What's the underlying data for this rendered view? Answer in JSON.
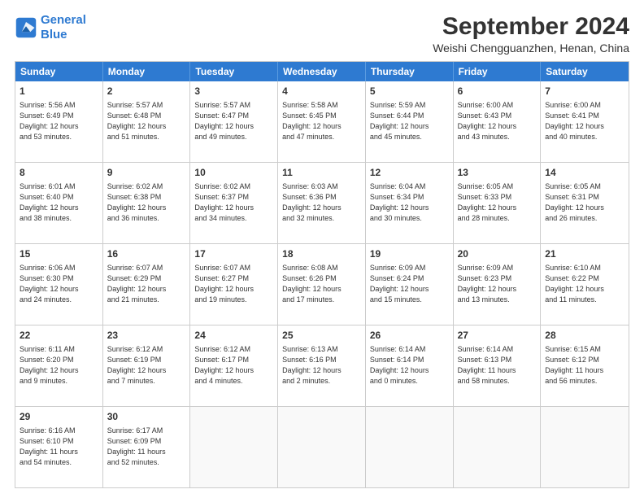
{
  "header": {
    "logo_general": "General",
    "logo_blue": "Blue",
    "month_title": "September 2024",
    "location": "Weishi Chengguanzhen, Henan, China"
  },
  "weekdays": [
    "Sunday",
    "Monday",
    "Tuesday",
    "Wednesday",
    "Thursday",
    "Friday",
    "Saturday"
  ],
  "rows": [
    [
      {
        "day": "1",
        "lines": [
          "Sunrise: 5:56 AM",
          "Sunset: 6:49 PM",
          "Daylight: 12 hours",
          "and 53 minutes."
        ]
      },
      {
        "day": "2",
        "lines": [
          "Sunrise: 5:57 AM",
          "Sunset: 6:48 PM",
          "Daylight: 12 hours",
          "and 51 minutes."
        ]
      },
      {
        "day": "3",
        "lines": [
          "Sunrise: 5:57 AM",
          "Sunset: 6:47 PM",
          "Daylight: 12 hours",
          "and 49 minutes."
        ]
      },
      {
        "day": "4",
        "lines": [
          "Sunrise: 5:58 AM",
          "Sunset: 6:45 PM",
          "Daylight: 12 hours",
          "and 47 minutes."
        ]
      },
      {
        "day": "5",
        "lines": [
          "Sunrise: 5:59 AM",
          "Sunset: 6:44 PM",
          "Daylight: 12 hours",
          "and 45 minutes."
        ]
      },
      {
        "day": "6",
        "lines": [
          "Sunrise: 6:00 AM",
          "Sunset: 6:43 PM",
          "Daylight: 12 hours",
          "and 43 minutes."
        ]
      },
      {
        "day": "7",
        "lines": [
          "Sunrise: 6:00 AM",
          "Sunset: 6:41 PM",
          "Daylight: 12 hours",
          "and 40 minutes."
        ]
      }
    ],
    [
      {
        "day": "8",
        "lines": [
          "Sunrise: 6:01 AM",
          "Sunset: 6:40 PM",
          "Daylight: 12 hours",
          "and 38 minutes."
        ]
      },
      {
        "day": "9",
        "lines": [
          "Sunrise: 6:02 AM",
          "Sunset: 6:38 PM",
          "Daylight: 12 hours",
          "and 36 minutes."
        ]
      },
      {
        "day": "10",
        "lines": [
          "Sunrise: 6:02 AM",
          "Sunset: 6:37 PM",
          "Daylight: 12 hours",
          "and 34 minutes."
        ]
      },
      {
        "day": "11",
        "lines": [
          "Sunrise: 6:03 AM",
          "Sunset: 6:36 PM",
          "Daylight: 12 hours",
          "and 32 minutes."
        ]
      },
      {
        "day": "12",
        "lines": [
          "Sunrise: 6:04 AM",
          "Sunset: 6:34 PM",
          "Daylight: 12 hours",
          "and 30 minutes."
        ]
      },
      {
        "day": "13",
        "lines": [
          "Sunrise: 6:05 AM",
          "Sunset: 6:33 PM",
          "Daylight: 12 hours",
          "and 28 minutes."
        ]
      },
      {
        "day": "14",
        "lines": [
          "Sunrise: 6:05 AM",
          "Sunset: 6:31 PM",
          "Daylight: 12 hours",
          "and 26 minutes."
        ]
      }
    ],
    [
      {
        "day": "15",
        "lines": [
          "Sunrise: 6:06 AM",
          "Sunset: 6:30 PM",
          "Daylight: 12 hours",
          "and 24 minutes."
        ]
      },
      {
        "day": "16",
        "lines": [
          "Sunrise: 6:07 AM",
          "Sunset: 6:29 PM",
          "Daylight: 12 hours",
          "and 21 minutes."
        ]
      },
      {
        "day": "17",
        "lines": [
          "Sunrise: 6:07 AM",
          "Sunset: 6:27 PM",
          "Daylight: 12 hours",
          "and 19 minutes."
        ]
      },
      {
        "day": "18",
        "lines": [
          "Sunrise: 6:08 AM",
          "Sunset: 6:26 PM",
          "Daylight: 12 hours",
          "and 17 minutes."
        ]
      },
      {
        "day": "19",
        "lines": [
          "Sunrise: 6:09 AM",
          "Sunset: 6:24 PM",
          "Daylight: 12 hours",
          "and 15 minutes."
        ]
      },
      {
        "day": "20",
        "lines": [
          "Sunrise: 6:09 AM",
          "Sunset: 6:23 PM",
          "Daylight: 12 hours",
          "and 13 minutes."
        ]
      },
      {
        "day": "21",
        "lines": [
          "Sunrise: 6:10 AM",
          "Sunset: 6:22 PM",
          "Daylight: 12 hours",
          "and 11 minutes."
        ]
      }
    ],
    [
      {
        "day": "22",
        "lines": [
          "Sunrise: 6:11 AM",
          "Sunset: 6:20 PM",
          "Daylight: 12 hours",
          "and 9 minutes."
        ]
      },
      {
        "day": "23",
        "lines": [
          "Sunrise: 6:12 AM",
          "Sunset: 6:19 PM",
          "Daylight: 12 hours",
          "and 7 minutes."
        ]
      },
      {
        "day": "24",
        "lines": [
          "Sunrise: 6:12 AM",
          "Sunset: 6:17 PM",
          "Daylight: 12 hours",
          "and 4 minutes."
        ]
      },
      {
        "day": "25",
        "lines": [
          "Sunrise: 6:13 AM",
          "Sunset: 6:16 PM",
          "Daylight: 12 hours",
          "and 2 minutes."
        ]
      },
      {
        "day": "26",
        "lines": [
          "Sunrise: 6:14 AM",
          "Sunset: 6:14 PM",
          "Daylight: 12 hours",
          "and 0 minutes."
        ]
      },
      {
        "day": "27",
        "lines": [
          "Sunrise: 6:14 AM",
          "Sunset: 6:13 PM",
          "Daylight: 11 hours",
          "and 58 minutes."
        ]
      },
      {
        "day": "28",
        "lines": [
          "Sunrise: 6:15 AM",
          "Sunset: 6:12 PM",
          "Daylight: 11 hours",
          "and 56 minutes."
        ]
      }
    ],
    [
      {
        "day": "29",
        "lines": [
          "Sunrise: 6:16 AM",
          "Sunset: 6:10 PM",
          "Daylight: 11 hours",
          "and 54 minutes."
        ]
      },
      {
        "day": "30",
        "lines": [
          "Sunrise: 6:17 AM",
          "Sunset: 6:09 PM",
          "Daylight: 11 hours",
          "and 52 minutes."
        ]
      },
      {
        "day": "",
        "lines": []
      },
      {
        "day": "",
        "lines": []
      },
      {
        "day": "",
        "lines": []
      },
      {
        "day": "",
        "lines": []
      },
      {
        "day": "",
        "lines": []
      }
    ]
  ]
}
